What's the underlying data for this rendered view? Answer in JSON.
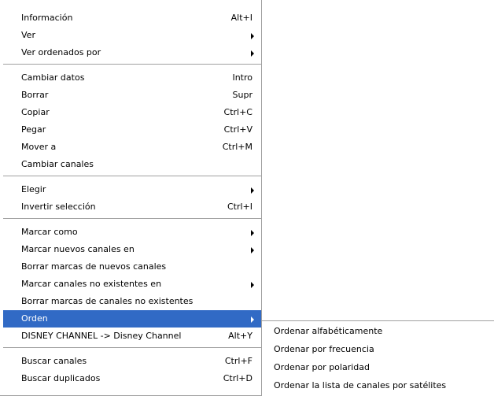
{
  "menu": {
    "groups": [
      [
        {
          "label": "Información",
          "shortcut": "Alt+I"
        },
        {
          "label": "Ver",
          "submenu": true
        },
        {
          "label": "Ver ordenados por",
          "submenu": true
        }
      ],
      [
        {
          "label": "Cambiar datos",
          "shortcut": "Intro"
        },
        {
          "label": "Borrar",
          "shortcut": "Supr"
        },
        {
          "label": "Copiar",
          "shortcut": "Ctrl+C"
        },
        {
          "label": "Pegar",
          "shortcut": "Ctrl+V"
        },
        {
          "label": "Mover a",
          "shortcut": "Ctrl+M"
        },
        {
          "label": "Cambiar canales"
        }
      ],
      [
        {
          "label": "Elegir",
          "submenu": true
        },
        {
          "label": "Invertir selección",
          "shortcut": "Ctrl+I"
        }
      ],
      [
        {
          "label": "Marcar como",
          "submenu": true
        },
        {
          "label": "Marcar nuevos canales en",
          "submenu": true
        },
        {
          "label": "Borrar marcas de nuevos canales"
        },
        {
          "label": "Marcar canales no existentes en",
          "submenu": true
        },
        {
          "label": "Borrar marcas de canales no existentes"
        },
        {
          "label": "Orden",
          "submenu": true,
          "selected": true
        },
        {
          "label": "DISNEY CHANNEL -> Disney Channel",
          "shortcut": "Alt+Y"
        }
      ],
      [
        {
          "label": "Buscar canales",
          "shortcut": "Ctrl+F"
        },
        {
          "label": "Buscar duplicados",
          "shortcut": "Ctrl+D"
        }
      ]
    ]
  },
  "submenu": {
    "items": [
      "Ordenar alfabéticamente",
      "Ordenar por frecuencia",
      "Ordenar por polaridad",
      "Ordenar la lista de canales por satélites"
    ]
  },
  "colors": {
    "highlight": "#316ac5",
    "separator": "#a0a0a0"
  }
}
